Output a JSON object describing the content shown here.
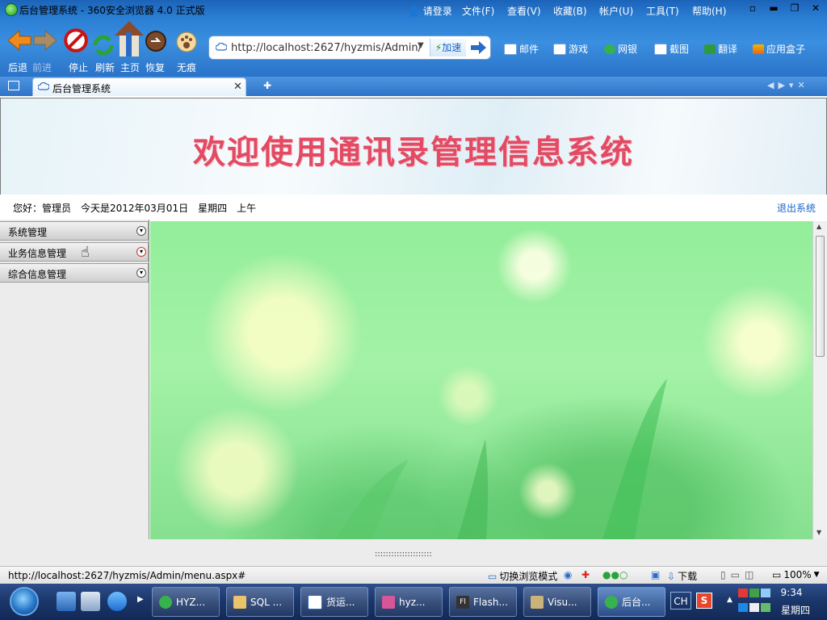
{
  "browser": {
    "window_title": "后台管理系统 - 360安全浏览器 4.0 正式版",
    "menu": [
      "请登录",
      "文件(F)",
      "查看(V)",
      "收藏(B)",
      "帐户(U)",
      "工具(T)",
      "帮助(H)"
    ],
    "nav_labels": {
      "back": "后退",
      "forward": "前进",
      "stop": "停止",
      "refresh": "刷新",
      "home": "主页",
      "restore": "恢复",
      "incognito": "无痕"
    },
    "address_url": "http://localhost:2627/hyzmis/Admin/...",
    "speed_label": "加速",
    "tools": [
      "邮件",
      "游戏",
      "网银",
      "截图",
      "翻译",
      "应用盒子"
    ],
    "tab_title": "后台管理系统"
  },
  "page": {
    "banner_title": "欢迎使用通讯录管理信息系统",
    "greeting": "您好：管理员　今天是2012年03月01日　星期四　上午",
    "logout_label": "退出系统",
    "sidebar_menu": [
      "系统管理",
      "业务信息管理",
      "综合信息管理"
    ],
    "splitter_dots": ":::::::::::::::::::::"
  },
  "status": {
    "url": "http://localhost:2627/hyzmis/Admin/menu.aspx#",
    "mode_switch": "切换浏览模式",
    "download": "下载",
    "zoom": "100%"
  },
  "taskbar": {
    "tasks": [
      "HYZ...",
      "SQL ...",
      "货运...",
      "hyz...",
      "Flash...",
      "Visu...",
      "后台..."
    ],
    "ime_lang": "CH",
    "ime_logo": "S",
    "time": "9:34",
    "day": "星期四"
  },
  "colors": {
    "banner_title": "#e34a63",
    "link": "#1a66c8",
    "chrome_blue": "#2a7fd4"
  }
}
